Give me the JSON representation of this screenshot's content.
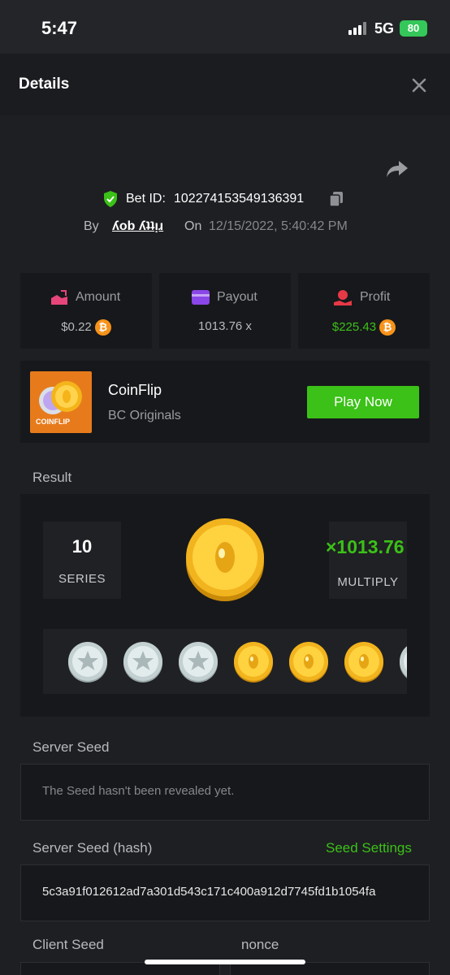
{
  "status_bar": {
    "time": "5:47",
    "network": "5G",
    "battery": "80"
  },
  "header": {
    "title": "Details"
  },
  "bet": {
    "id_label": "Bet ID:",
    "id_value": "102274153549136391",
    "by_label": "By",
    "user": "ʎob ʎʇʇı̣ɹ",
    "on_label": "On",
    "date": "12/15/2022, 5:40:42 PM"
  },
  "stats": {
    "amount": {
      "label": "Amount",
      "value": "$0.22"
    },
    "payout": {
      "label": "Payout",
      "value": "1013.76 x"
    },
    "profit": {
      "label": "Profit",
      "value": "$225.43"
    }
  },
  "game": {
    "thumb_text": "COINFLIP",
    "name": "CoinFlip",
    "provider": "BC Originals",
    "play_label": "Play Now"
  },
  "result": {
    "label": "Result",
    "series_value": "10",
    "series_label": "SERIES",
    "multiply_value": "×1013.76",
    "multiply_label": "MULTIPLY",
    "coin_sequence": [
      "silver",
      "silver",
      "silver",
      "gold",
      "gold",
      "gold",
      "silver"
    ]
  },
  "server_seed": {
    "label": "Server Seed",
    "value": "The Seed hasn't been revealed yet."
  },
  "server_seed_hash": {
    "label": "Server Seed (hash)",
    "settings_label": "Seed Settings",
    "value": "5c3a91f012612ad7a301d543c171c400a912d7745fd1b1054fa"
  },
  "client_seed": {
    "label": "Client Seed"
  },
  "nonce": {
    "label": "nonce"
  },
  "colors": {
    "accent_green": "#3bc117",
    "btc_orange": "#f7931a",
    "background": "#1e1f23",
    "card": "#17181b"
  }
}
